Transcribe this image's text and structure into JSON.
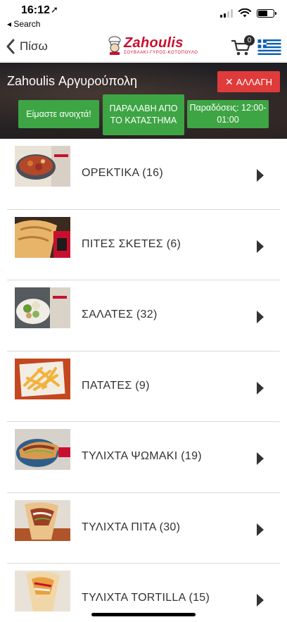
{
  "status_bar": {
    "time": "16:12",
    "location_glyph": "➚",
    "back_app": "◂ Search"
  },
  "nav": {
    "back_label": "Πίσω",
    "logo_word": "Zahoulis",
    "logo_tagline": "ΣΟΥΒΛΑΚΙ-ΓΥΡΟΣ-ΚΟΤΟΠΟΥΛΟ",
    "cart_count": "0"
  },
  "store": {
    "name": "Zahoulis Αργυρούπολη",
    "change_label": "ΑΛΛΑΓΗ",
    "open_status": "Είμαστε ανοιχτά!",
    "pickup_label": "ΠΑΡΑΛΑΒΗ ΑΠΟ ΤΟ ΚΑΤΑΣΤΗΜΑ",
    "delivery_hours": "Παραδόσεις: 12:00-01:00"
  },
  "categories": [
    {
      "label": "ΟΡΕΚΤΙΚΑ",
      "count": "(16)",
      "thumb": "appetizers"
    },
    {
      "label": "ΠΙΤΕΣ ΣΚΕΤΕΣ",
      "count": "(6)",
      "thumb": "pitas"
    },
    {
      "label": "ΣΑΛΑΤΕΣ",
      "count": "(32)",
      "thumb": "salads"
    },
    {
      "label": "ΠΑΤΑΤΕΣ",
      "count": "(9)",
      "thumb": "fries"
    },
    {
      "label": "ΤΥΛΙΧΤΑ ΨΩΜΑΚΙ",
      "count": "(19)",
      "thumb": "wrap-bread"
    },
    {
      "label": "ΤΥΛΙΧΤΑ ΠΙΤΑ",
      "count": "(30)",
      "thumb": "wrap-pita"
    },
    {
      "label": "ΤΥΛΙΧΤΑ TORTILLA",
      "count": "(15)",
      "thumb": "wrap-tortilla"
    }
  ],
  "colors": {
    "brand_red": "#c8102e",
    "change_button": "#e03b3b",
    "status_green": "#3ea544"
  }
}
